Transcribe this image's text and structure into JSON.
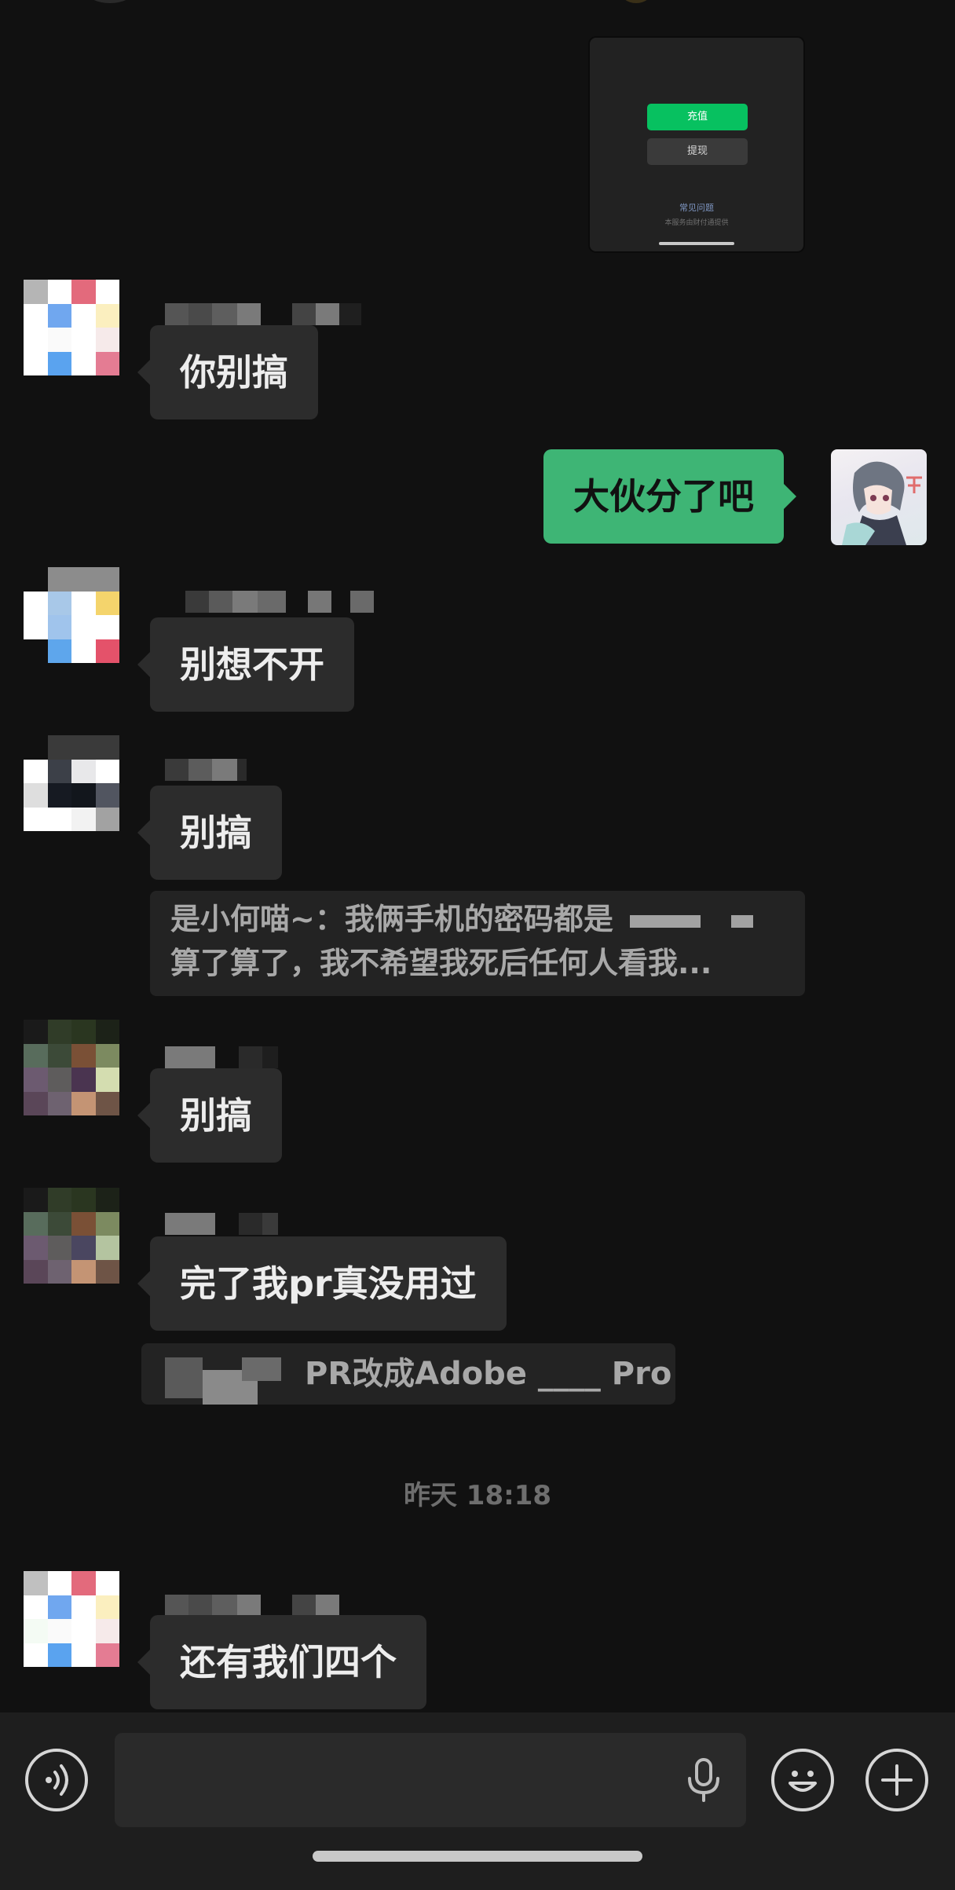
{
  "image_message": {
    "primary_button": "充值",
    "secondary_button": "提现",
    "link": "常见问题",
    "note": "本服务由财付通提供"
  },
  "messages": [
    {
      "text": "你别搞"
    },
    {
      "text": "大伙分了吧"
    },
    {
      "text": "别想不开"
    },
    {
      "text": "别搞"
    },
    {
      "text": "别搞"
    },
    {
      "text": "完了我pr真没用过"
    },
    {
      "text": "还有我们四个"
    }
  ],
  "quote": {
    "line1": "是小何喵~：我俩手机的密码都是",
    "line2": "算了算了，我不希望我死后任何人看我..."
  },
  "quote2": {
    "text": "PR改成Adobe ____ Pro"
  },
  "time_separator": "昨天 18:18",
  "input": {
    "placeholder": ""
  },
  "icons": {
    "voice": "voice-mode-icon",
    "mic": "microphone-icon",
    "emoji": "emoji-icon",
    "plus": "plus-icon"
  },
  "colors": {
    "background": "#111111",
    "bubble_other": "#2c2c2c",
    "bubble_mine": "#3eb575",
    "wechat_green": "#07c160"
  }
}
